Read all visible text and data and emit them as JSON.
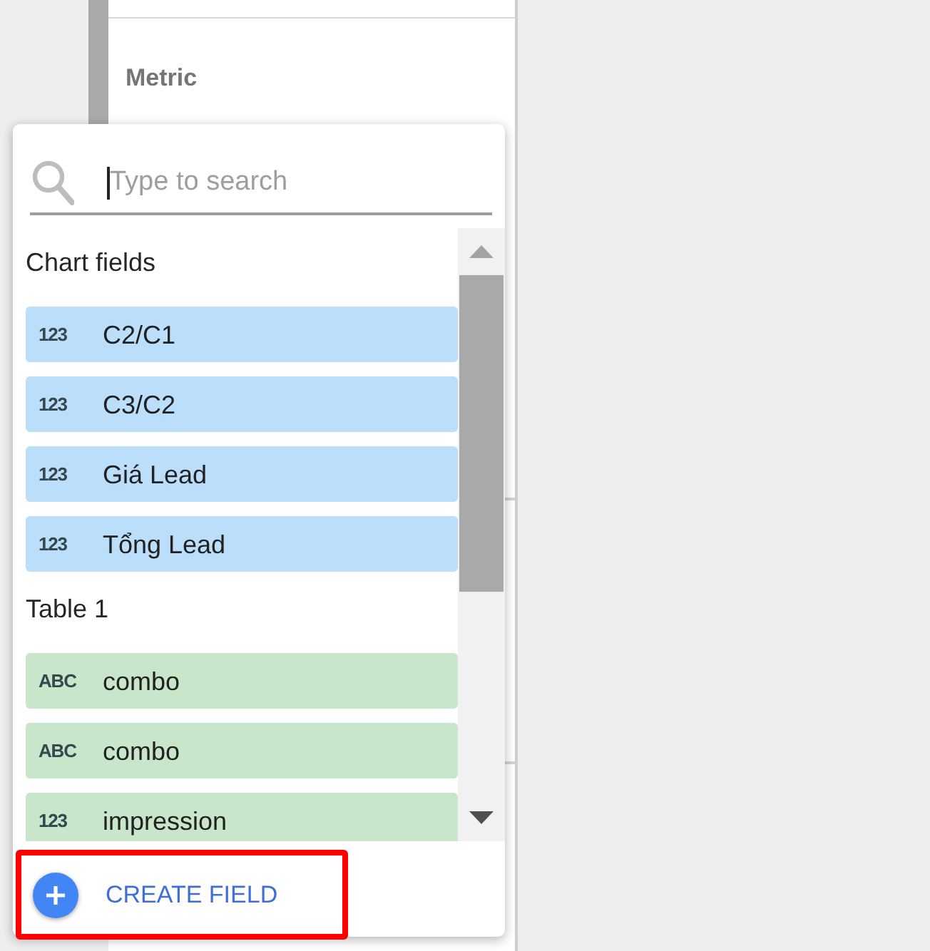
{
  "panel": {
    "section_label": "Metric"
  },
  "field_picker": {
    "search": {
      "placeholder": "Type to search"
    },
    "sections": [
      {
        "title": "Chart fields",
        "kind": "chart",
        "fields": [
          {
            "type_icon": "123",
            "name": "C2/C1"
          },
          {
            "type_icon": "123",
            "name": "C3/C2"
          },
          {
            "type_icon": "123",
            "name": "Giá Lead"
          },
          {
            "type_icon": "123",
            "name": "Tổng Lead"
          }
        ]
      },
      {
        "title": "Table 1",
        "kind": "source",
        "fields": [
          {
            "type_icon": "ABC",
            "name": "combo"
          },
          {
            "type_icon": "ABC",
            "name": "combo"
          },
          {
            "type_icon": "123",
            "name": "impression"
          }
        ]
      }
    ],
    "create_button": {
      "label": "CREATE FIELD",
      "highlighted": true
    }
  }
}
